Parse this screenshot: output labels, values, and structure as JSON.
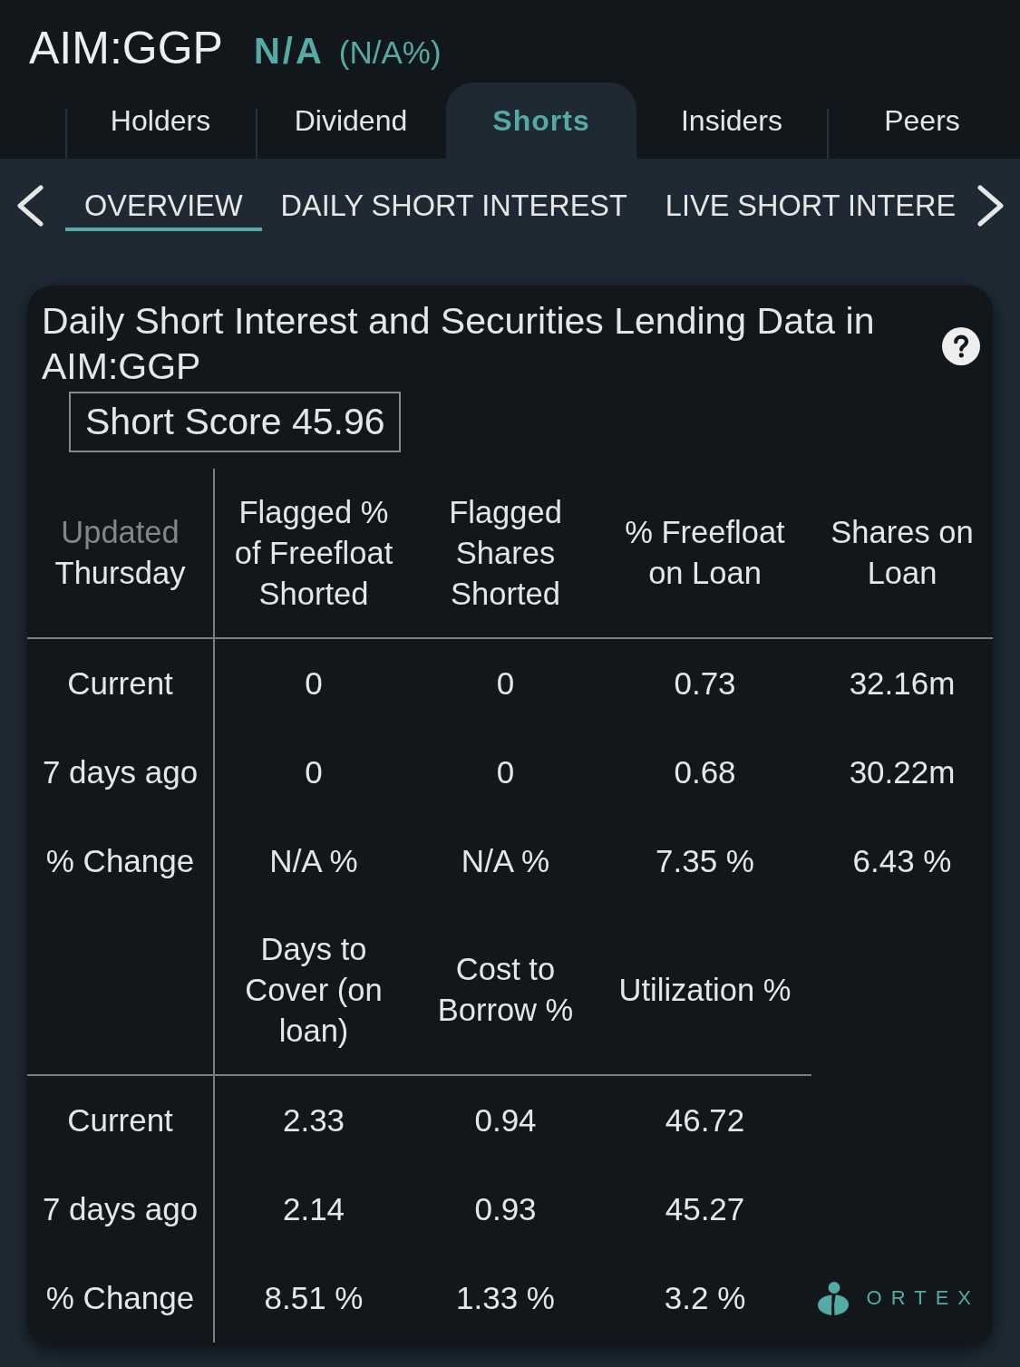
{
  "header": {
    "symbol": "AIM:GGP",
    "change": "N/A",
    "change_percent": "(N/A%)"
  },
  "tabs": [
    {
      "label": "Holders",
      "selected": false
    },
    {
      "label": "Dividend",
      "selected": false
    },
    {
      "label": "Shorts",
      "selected": true
    },
    {
      "label": "Insiders",
      "selected": false
    },
    {
      "label": "Peers",
      "selected": false
    }
  ],
  "subtabs": [
    {
      "label": "OVERVIEW",
      "selected": true
    },
    {
      "label": "DAILY SHORT INTEREST",
      "selected": false
    },
    {
      "label": "LIVE SHORT INTERE",
      "selected": false
    }
  ],
  "card": {
    "title": "Daily Short Interest and Securities Lending Data in AIM:GGP",
    "short_score": "Short Score 45.96",
    "tables": [
      {
        "corner": {
          "caption": "Updated",
          "label": "Thursday"
        },
        "columns": [
          "Flagged % of Freefloat Shorted",
          "Flagged Shares Shorted",
          "% Freefloat on Loan",
          "Shares on Loan"
        ],
        "rows": [
          {
            "label": "Current",
            "values": [
              "0",
              "0",
              "0.73",
              "32.16m"
            ]
          },
          {
            "label": "7 days ago",
            "values": [
              "0",
              "0",
              "0.68",
              "30.22m"
            ]
          },
          {
            "label": "% Change",
            "values": [
              "N/A %",
              "N/A %",
              "7.35 %",
              "6.43 %"
            ]
          }
        ]
      },
      {
        "columns": [
          "Days to Cover (on loan)",
          "Cost to Borrow %",
          "Utilization %"
        ],
        "rows": [
          {
            "label": "Current",
            "values": [
              "2.33",
              "0.94",
              "46.72"
            ]
          },
          {
            "label": "7 days ago",
            "values": [
              "2.14",
              "0.93",
              "45.27"
            ]
          },
          {
            "label": "% Change",
            "values": [
              "8.51 %",
              "1.33 %",
              "3.2 %"
            ]
          }
        ]
      }
    ],
    "brand": "ORTEX"
  }
}
